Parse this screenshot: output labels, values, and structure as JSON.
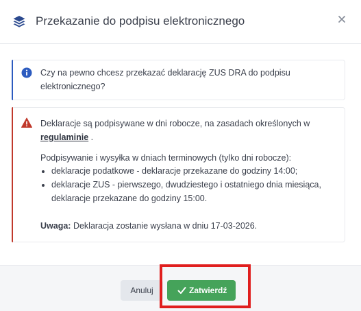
{
  "dialog": {
    "title": "Przekazanie do podpisu elektronicznego",
    "icon": "layers-icon",
    "close_icon": "close-icon"
  },
  "info_alert": {
    "icon": "info-circle-icon",
    "text": "Czy na pewno chcesz przekazać deklarację ZUS DRA do podpisu elektronicznego?"
  },
  "warning_alert": {
    "icon": "warning-triangle-icon",
    "line1_prefix": "Deklaracje są podpisywane w dni robocze, na zasadach określonych w",
    "link_text": "regulaminie",
    "line1_suffix": ".",
    "line2": "Podpisywanie i wysyłka w dniach terminowych (tylko dni robocze):",
    "bullets": [
      "deklaracje podatkowe - deklaracje przekazane do godziny 14:00;",
      "deklaracje ZUS - pierwszego, dwudziestego i ostatniego dnia miesiąca, deklaracje przekazane do godziny 15:00."
    ],
    "note_label": "Uwaga:",
    "note_text": "Deklaracja zostanie wysłana w dniu 17-03-2026."
  },
  "footer": {
    "cancel_label": "Anuluj",
    "confirm_label": "Zatwierdź",
    "confirm_icon": "check-icon"
  },
  "colors": {
    "info_accent": "#2c5bbf",
    "warning_accent": "#c0392b",
    "confirm_button": "#45a35a",
    "highlight": "#e01e1e"
  }
}
